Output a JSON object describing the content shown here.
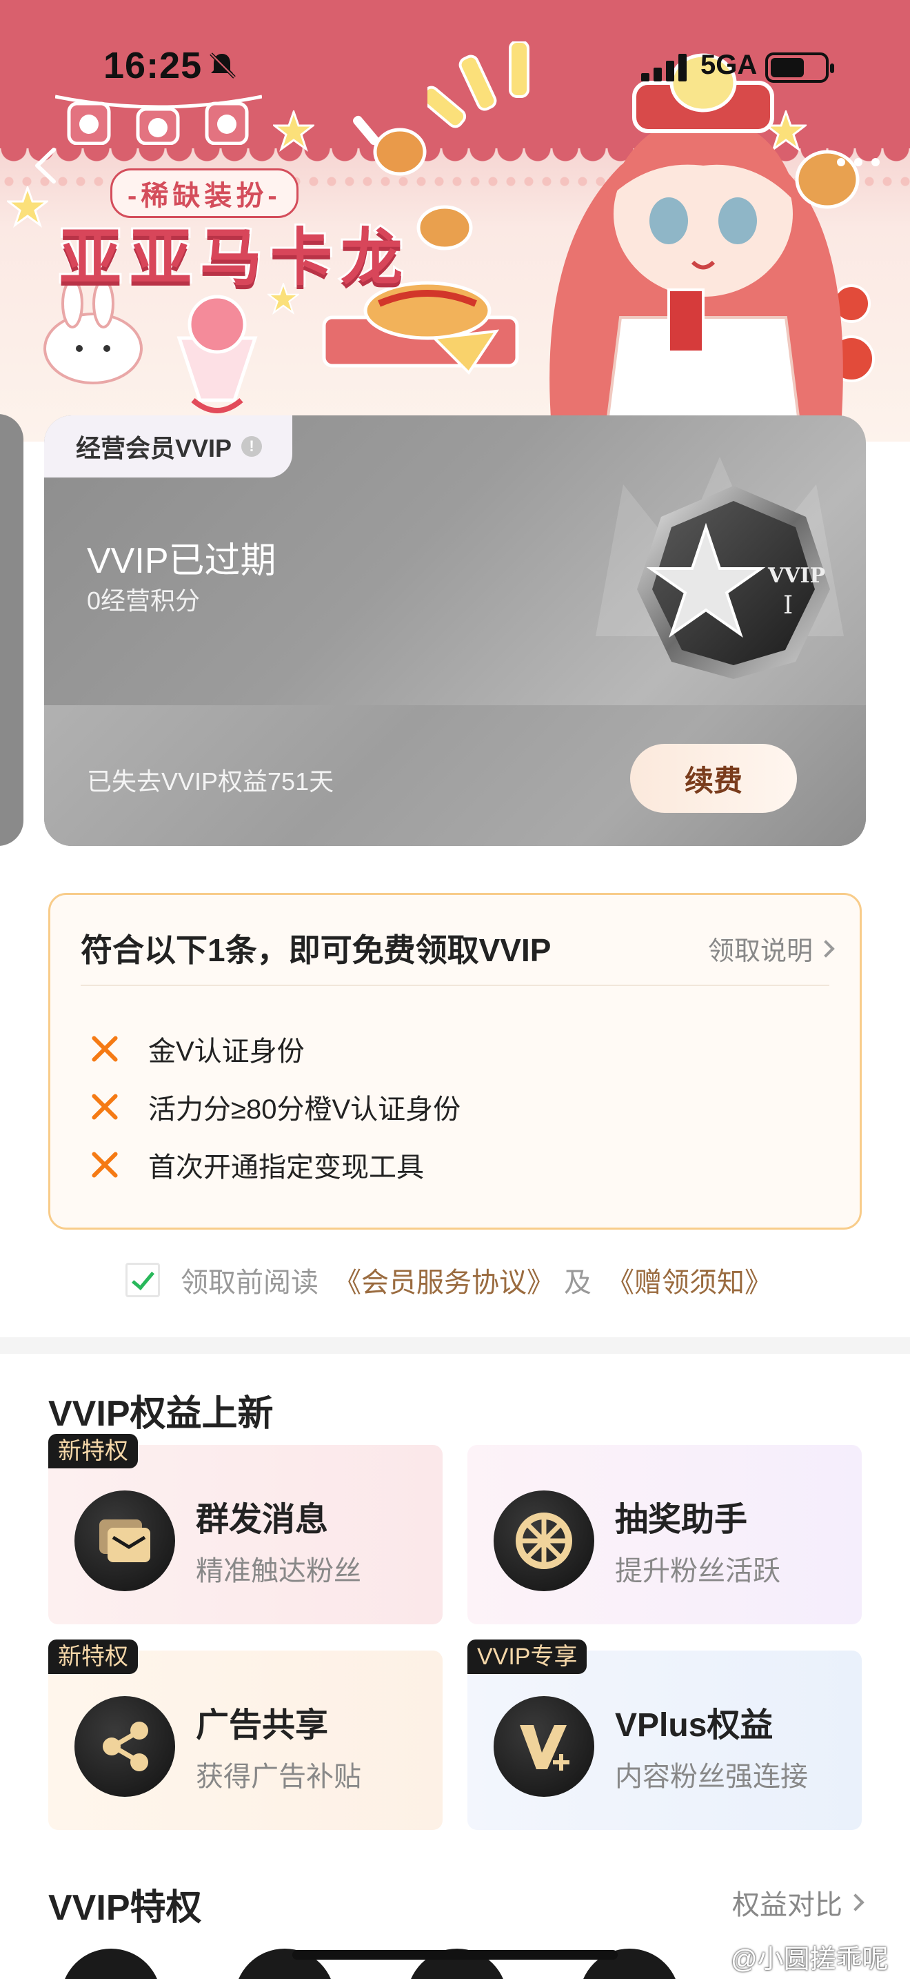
{
  "status_bar": {
    "time": "16:25",
    "network": "5GA",
    "icons": [
      "bell-off-icon",
      "signal-icon",
      "battery-icon"
    ]
  },
  "hero": {
    "subtitle": "-稀缺装扮-",
    "title": "亚亚马卡龙",
    "colors": {
      "banner_red": "#d9606d",
      "title_red": "#d8465a"
    }
  },
  "vip_card": {
    "tab_label": "经营会员VVIP",
    "info_icon_glyph": "!",
    "status": "VVIP已过期",
    "points": "0经营积分",
    "lost_benefits": "已失去VVIP权益751天",
    "renew_label": "续费",
    "badge_text": "VVIP",
    "badge_level": "I"
  },
  "free_vvip": {
    "title": "符合以下1条，即可免费领取VVIP",
    "help_label": "领取说明",
    "conditions": [
      {
        "text": "金V认证身份",
        "met": false
      },
      {
        "text": "活力分≥80分橙V认证身份",
        "met": false
      },
      {
        "text": "首次开通指定变现工具",
        "met": false
      }
    ]
  },
  "agreement": {
    "checked": true,
    "prefix": "领取前阅读",
    "link1": "《会员服务协议》",
    "and": "及",
    "link2": "《赠领须知》"
  },
  "new_benefits": {
    "title": "VVIP权益上新",
    "items": [
      {
        "tag": "新特权",
        "name": "群发消息",
        "desc": "精准触达粉丝",
        "icon": "message-icon"
      },
      {
        "tag": "",
        "name": "抽奖助手",
        "desc": "提升粉丝活跃",
        "icon": "lottery-wheel-icon"
      },
      {
        "tag": "新特权",
        "name": "广告共享",
        "desc": "获得广告补贴",
        "icon": "share-icon"
      },
      {
        "tag": "VVIP专享",
        "name": "VPlus权益",
        "desc": "内容粉丝强连接",
        "icon": "vplus-icon"
      }
    ]
  },
  "privileges": {
    "title": "VVIP特权",
    "compare_label": "权益对比"
  },
  "watermark": "@小圆搓乖呢"
}
